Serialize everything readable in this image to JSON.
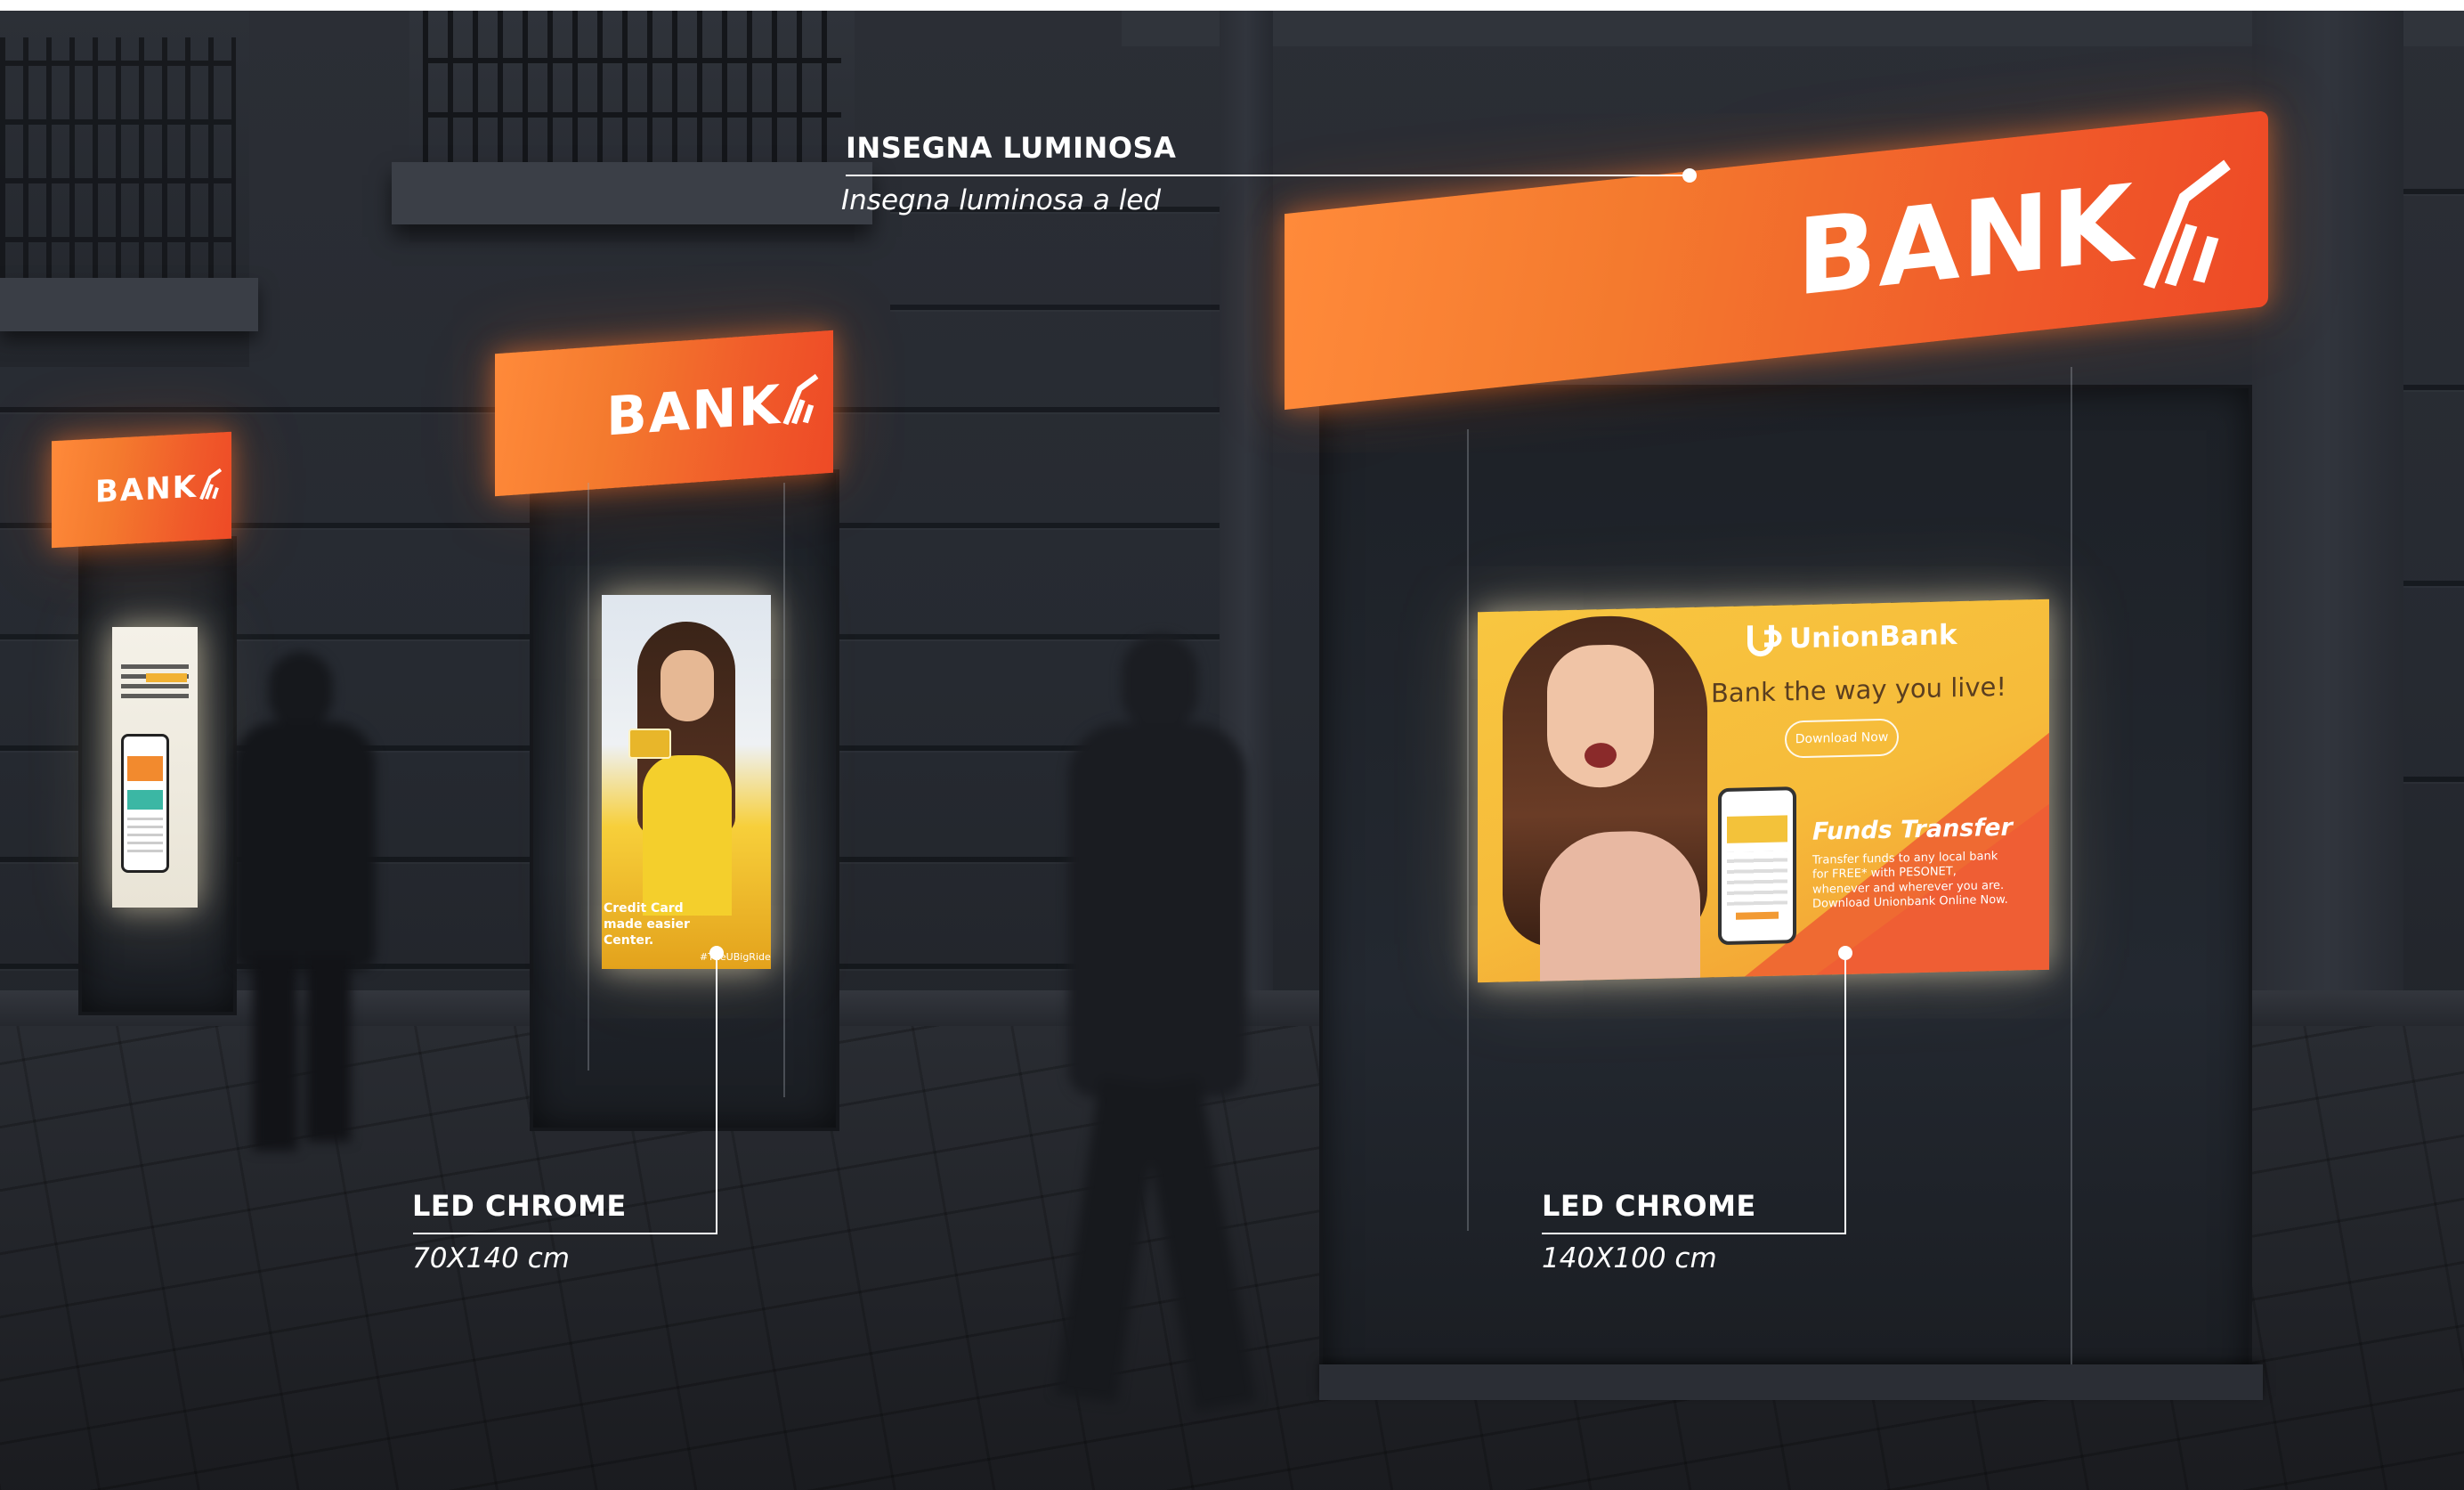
{
  "annotations": {
    "sign": {
      "title": "INSEGNA LUMINOSA",
      "subtitle": "Insegna luminosa a led"
    },
    "panel_small": {
      "title": "LED CHROME",
      "subtitle": "70X140 cm"
    },
    "panel_large": {
      "title": "LED CHROME",
      "subtitle": "140X100 cm"
    }
  },
  "signs": {
    "word": "BANK"
  },
  "ads": {
    "unionbank": {
      "brand": "UnionBank",
      "tagline": "Bank the way you live!",
      "button": "Download Now",
      "headline": "Funds Transfer",
      "body": "Transfer funds to any local bank for FREE* with PESONET, whenever and wherever you are. Download Unionbank Online Now."
    },
    "card_poster": {
      "lines": [
        "Credit Card",
        "made easier",
        "Center."
      ],
      "hashtag": "#TheUBigRide"
    }
  },
  "colors": {
    "sign_orange": "#f47a2e",
    "sign_red": "#ee4a26",
    "ad_yellow": "#f6c23e",
    "ad_orange": "#f07a2e",
    "facade": "#2b2e35"
  },
  "icons": {
    "bank_logo": "chevron-chart-icon",
    "unionbank_logo": "ub-monogram-icon",
    "phone": "smartphone-icon"
  }
}
